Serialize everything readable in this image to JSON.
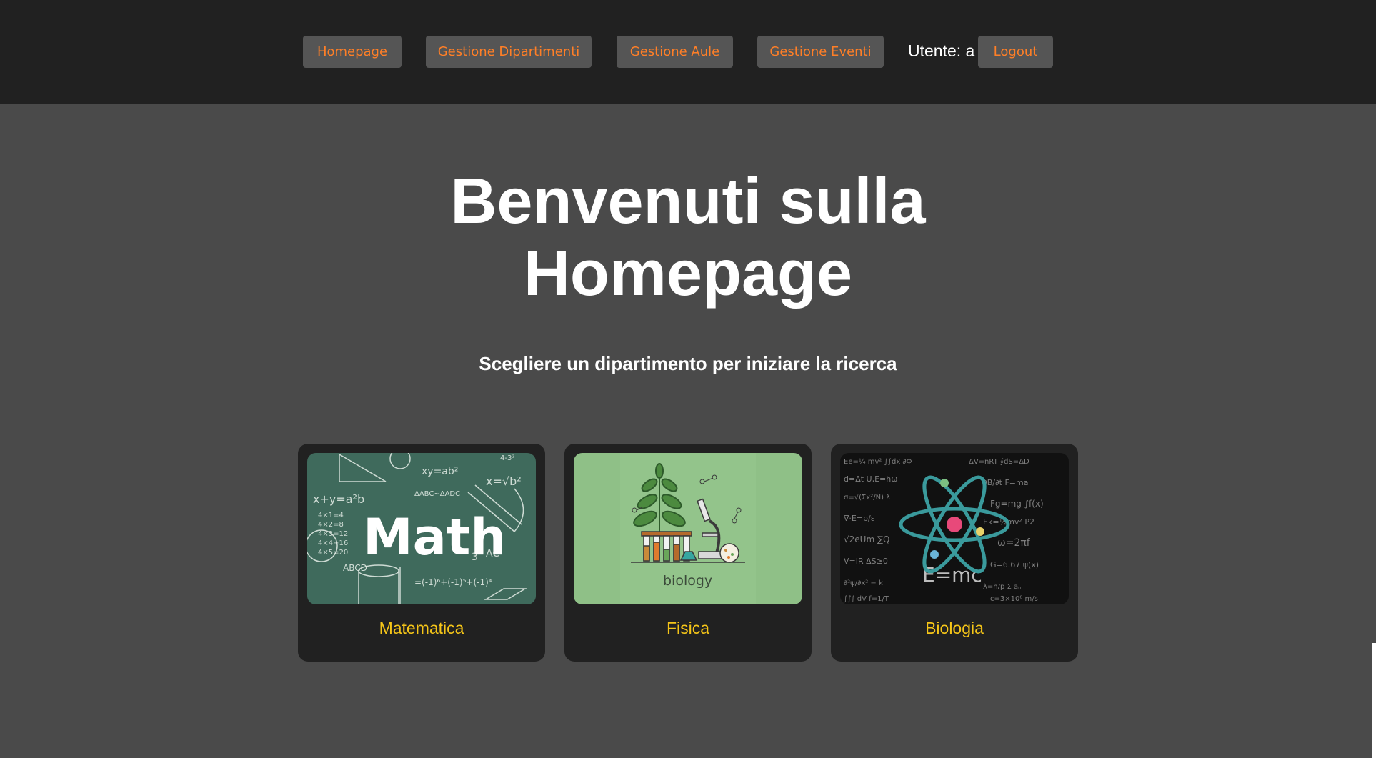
{
  "nav": {
    "homepage": "Homepage",
    "departments": "Gestione Dipartimenti",
    "rooms": "Gestione Aule",
    "events": "Gestione Eventi",
    "user_prefix": "Utente:",
    "user_name": "a",
    "logout": "Logout"
  },
  "hero": {
    "title_line1": "Benvenuti sulla",
    "title_line2": "Homepage",
    "subtitle": "Scegliere un dipartimento per iniziare la ricerca"
  },
  "cards": [
    {
      "label": "Matematica",
      "image_text": "Math",
      "icon": "math-chalkboard-image"
    },
    {
      "label": "Fisica",
      "image_text": "biology",
      "icon": "biology-lab-image"
    },
    {
      "label": "Biologia",
      "image_text": "E=mc",
      "icon": "atom-image"
    }
  ],
  "colors": {
    "topbar": "#212121",
    "background": "#4a4a4a",
    "nav_button": "#555555",
    "nav_text": "#ff7f27",
    "card": "#212121",
    "card_label": "#f5c518"
  }
}
